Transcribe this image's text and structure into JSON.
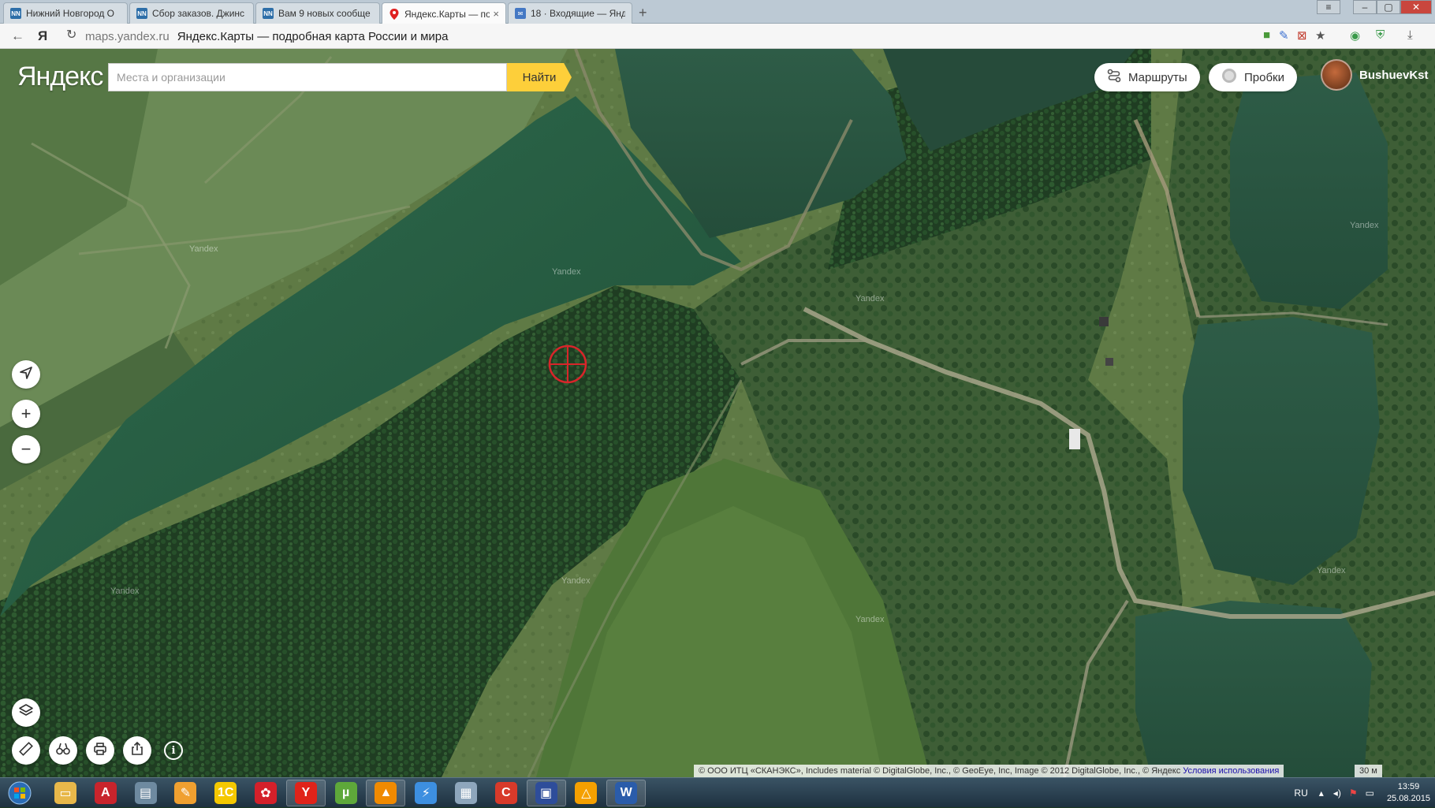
{
  "browser": {
    "tabs": [
      {
        "label": "Нижний Новгород О",
        "fav": "NN",
        "fav_color": "#2d6ea8"
      },
      {
        "label": "Сбор заказов. Джинс",
        "fav": "NN",
        "fav_color": "#2d6ea8"
      },
      {
        "label": "Вам 9 новых сообще",
        "fav": "NN",
        "fav_color": "#2d6ea8"
      },
      {
        "label": "Яндекс.Карты — подр",
        "fav": "pin",
        "fav_color": "#e02020",
        "active": true
      },
      {
        "label": "18 · Входящие — Янд",
        "fav": "mail",
        "fav_color": "#4478c4"
      }
    ],
    "close_tab": "×",
    "new_tab": "+",
    "window_buttons": [
      "≡",
      "–",
      "▢",
      "✕"
    ],
    "back": "←",
    "yandex_btn": "Я",
    "reload": "↻",
    "url_domain": "maps.yandex.ru",
    "url_title": "Яндекс.Карты — подробная карта России и мира"
  },
  "header": {
    "logo": "Яндекс",
    "search_placeholder": "Места и организации",
    "search_button": "Найти",
    "routes_label": "Маршруты",
    "traffic_label": "Пробки",
    "username": "BushuevKst"
  },
  "controls": {
    "zoom_in": "+",
    "zoom_out": "−",
    "info": "i"
  },
  "watermarks": [
    "Yandex",
    "Yandex",
    "Yandex",
    "Yandex",
    "Yandex",
    "Yandex",
    "Yandex",
    "Yandex"
  ],
  "footer": {
    "copyright": "© ООО ИТЦ «СКАНЭКС», Includes material © DigitalGlobe, Inc., © GeoEye, Inc, Image © 2012 DigitalGlobe, Inc., © Яндекс",
    "terms_link": "Условия использования",
    "scale": "30 м"
  },
  "taskbar": {
    "lang": "RU",
    "time": "13:59",
    "date": "25.08.2015",
    "apps": [
      {
        "name": "explorer",
        "color": "#e8b84a",
        "glyph": "▭"
      },
      {
        "name": "pdf",
        "color": "#c8242c",
        "glyph": "A"
      },
      {
        "name": "drive",
        "color": "#6e8aa0",
        "glyph": "▤"
      },
      {
        "name": "paint",
        "color": "#f0a030",
        "glyph": "✎"
      },
      {
        "name": "1c",
        "color": "#f5c800",
        "glyph": "1С"
      },
      {
        "name": "huawei",
        "color": "#d4202a",
        "glyph": "✿"
      },
      {
        "name": "yandex-browser",
        "color": "#e0231a",
        "glyph": "Y"
      },
      {
        "name": "utorrent",
        "color": "#5ea83a",
        "glyph": "µ"
      },
      {
        "name": "vlc",
        "color": "#f08a00",
        "glyph": "▲"
      },
      {
        "name": "thunderbolt",
        "color": "#3d8fe0",
        "glyph": "⚡"
      },
      {
        "name": "calculator",
        "color": "#8ea6bc",
        "glyph": "▦"
      },
      {
        "name": "ccleaner",
        "color": "#d83a2a",
        "glyph": "C"
      },
      {
        "name": "floppy",
        "color": "#2e4d9a",
        "glyph": "▣"
      },
      {
        "name": "aimp",
        "color": "#f5a000",
        "glyph": "△"
      },
      {
        "name": "word",
        "color": "#2a5caa",
        "glyph": "W"
      }
    ]
  }
}
